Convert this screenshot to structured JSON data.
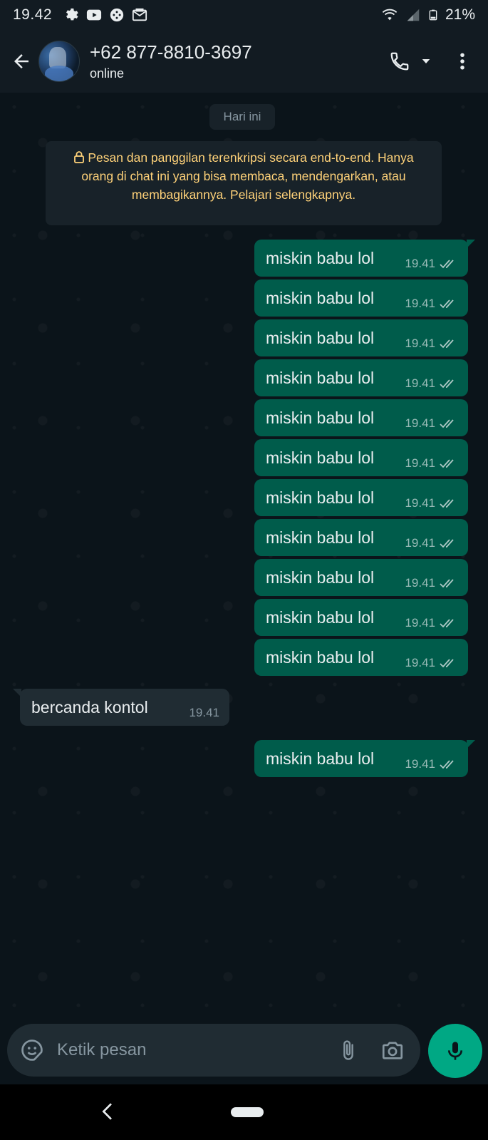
{
  "status_bar": {
    "time": "19.42",
    "battery": "21%",
    "icons": [
      "settings-icon",
      "youtube-icon",
      "game-controller-icon",
      "mail-icon",
      "wifi-icon",
      "signal-icon",
      "battery-icon"
    ]
  },
  "header": {
    "contact_name": "+62 877-8810-3697",
    "contact_status": "online",
    "icons": [
      "back-arrow-icon",
      "call-icon",
      "dropdown-arrow-icon",
      "more-vert-icon"
    ]
  },
  "chat": {
    "day_separator": "Hari ini",
    "encryption_notice": "Pesan dan panggilan terenkripsi secara end-to-end. Hanya orang di chat ini yang bisa membaca, mendengarkan, atau membagikannya. Pelajari selengkapnya.",
    "messages": [
      {
        "direction": "out",
        "text": "miskin babu lol",
        "time": "19.41",
        "status": "read"
      },
      {
        "direction": "out",
        "text": "miskin babu lol",
        "time": "19.41",
        "status": "read"
      },
      {
        "direction": "out",
        "text": "miskin babu lol",
        "time": "19.41",
        "status": "read"
      },
      {
        "direction": "out",
        "text": "miskin babu lol",
        "time": "19.41",
        "status": "read"
      },
      {
        "direction": "out",
        "text": "miskin babu lol",
        "time": "19.41",
        "status": "read"
      },
      {
        "direction": "out",
        "text": "miskin babu lol",
        "time": "19.41",
        "status": "read"
      },
      {
        "direction": "out",
        "text": "miskin babu lol",
        "time": "19.41",
        "status": "read"
      },
      {
        "direction": "out",
        "text": "miskin babu lol",
        "time": "19.41",
        "status": "read"
      },
      {
        "direction": "out",
        "text": "miskin babu lol",
        "time": "19.41",
        "status": "read"
      },
      {
        "direction": "out",
        "text": "miskin babu lol",
        "time": "19.41",
        "status": "read"
      },
      {
        "direction": "out",
        "text": "miskin babu lol",
        "time": "19.41",
        "status": "read"
      },
      {
        "direction": "in",
        "text": "bercanda kontol",
        "time": "19.41"
      },
      {
        "direction": "out",
        "text": "miskin babu lol",
        "time": "19.41",
        "status": "read"
      }
    ]
  },
  "composer": {
    "placeholder": "Ketik pesan",
    "icons": [
      "sticker-icon",
      "attach-icon",
      "camera-icon",
      "mic-icon"
    ]
  },
  "colors": {
    "background": "#0b141a",
    "bar": "#121b22",
    "outgoing_bubble": "#005c4b",
    "incoming_bubble": "#202c33",
    "accent": "#00a884",
    "notice_text": "#ffd279",
    "read_ticks": "#53bdeb"
  }
}
